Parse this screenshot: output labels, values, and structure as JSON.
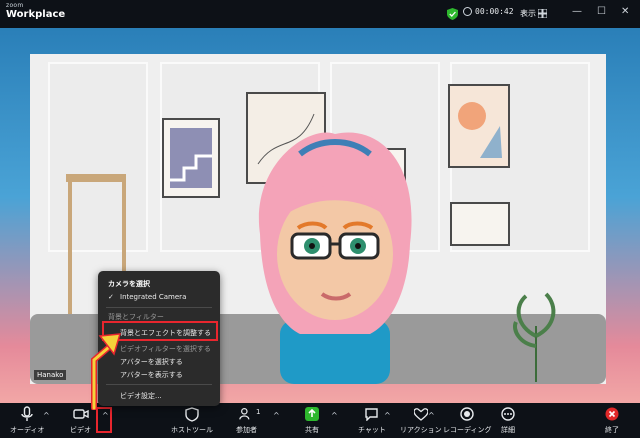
{
  "window": {
    "brand_top": "zoom",
    "brand_bottom": "Workplace",
    "timer": "00:00:42",
    "timer_caret": "⌄",
    "view_label": "表示",
    "controls": [
      "—",
      "☐",
      "✕"
    ]
  },
  "video": {
    "participant_name": "Hanako"
  },
  "menu": {
    "camera_header": "カメラを選択",
    "camera_check": "✓",
    "camera_selected": "Integrated Camera",
    "dim_item_1": "背景とフィルター",
    "adjust_effects": "背景とエフェクトを調整する",
    "dim_item_2": "ビデオフィルターを選択する",
    "choose_avatar": "アバターを選択する",
    "show_avatar": "アバターを表示する",
    "video_settings": "ビデオ設定..."
  },
  "toolbar": {
    "audio": "オーディオ",
    "video": "ビデオ",
    "host_tools": "ホストツール",
    "participants": "参加者",
    "participants_count": "1",
    "share": "共有",
    "chat": "チャット",
    "reactions": "リアクション",
    "record": "レコーディング",
    "more": "詳細",
    "end": "終了",
    "caret": "^"
  },
  "colors": {
    "accent_green": "#2eb82e",
    "highlight_red": "#e8262e",
    "arrow_yellow": "#f5d23a",
    "end_red": "#e02828"
  }
}
